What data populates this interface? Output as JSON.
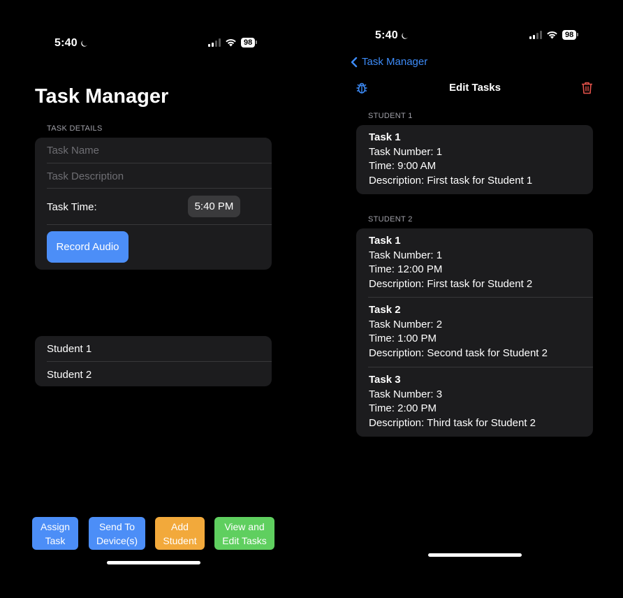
{
  "left": {
    "status": {
      "time": "5:40",
      "battery": "98"
    },
    "title": "Task Manager",
    "task_details": {
      "section_label": "TASK DETAILS",
      "task_name_placeholder": "Task Name",
      "task_description_placeholder": "Task Description",
      "task_time_label": "Task Time:",
      "task_time_value": "5:40 PM",
      "record_audio_label": "Record Audio"
    },
    "students": [
      "Student 1",
      "Student 2"
    ],
    "actions": [
      {
        "line1": "Assign",
        "line2": "Task",
        "color": "#4c8ef7"
      },
      {
        "line1": "Send To",
        "line2": "Device(s)",
        "color": "#4c8ef7"
      },
      {
        "line1": "Add",
        "line2": "Student",
        "color": "#f2a93b"
      },
      {
        "line1": "View and",
        "line2": "Edit Tasks",
        "color": "#5fcf5f"
      }
    ]
  },
  "right": {
    "status": {
      "time": "5:40",
      "battery": "98"
    },
    "back_label": "Task Manager",
    "nav_title": "Edit Tasks",
    "icons": {
      "left": "bug-icon",
      "right": "trash-icon"
    },
    "groups": [
      {
        "label": "STUDENT 1",
        "tasks": [
          {
            "name": "Task 1",
            "number": "Task Number: 1",
            "time": "Time: 9:00 AM",
            "description": "Description: First task for Student 1"
          }
        ]
      },
      {
        "label": "STUDENT 2",
        "tasks": [
          {
            "name": "Task 1",
            "number": "Task Number: 1",
            "time": "Time: 12:00 PM",
            "description": "Description: First task for Student 2"
          },
          {
            "name": "Task 2",
            "number": "Task Number: 2",
            "time": "Time: 1:00 PM",
            "description": "Description: Second task for Student 2"
          },
          {
            "name": "Task 3",
            "number": "Task Number: 3",
            "time": "Time: 2:00 PM",
            "description": "Description: Third task for Student 2"
          }
        ]
      }
    ]
  },
  "colors": {
    "accent_blue": "#4c8ef7",
    "link_blue": "#3d8bf7",
    "delete_red": "#e5534b",
    "card_bg": "#1c1c1e"
  }
}
